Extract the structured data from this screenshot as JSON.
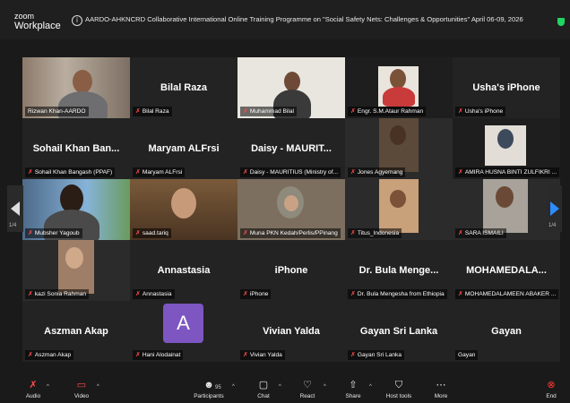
{
  "app": {
    "logo_line1": "zoom",
    "logo_line2": "Workplace"
  },
  "meeting": {
    "info_icon": "i",
    "title": "AARDO-AHKNCRD Collaborative International Online Training Programme on \"Social Safety Nets: Challenges & Opportunities\" April 06-09, 2026"
  },
  "tiles": [
    {
      "big": "",
      "label": "Rizwan Khan-AARDO",
      "muted": false,
      "video": true
    },
    {
      "big": "Bilal Raza",
      "label": "Bilal Raza",
      "muted": true,
      "video": false
    },
    {
      "big": "",
      "label": "Muhammad Bilal",
      "muted": true,
      "video": true
    },
    {
      "big": "",
      "label": "Engr. S.M.Ataur Rahman",
      "muted": true,
      "video": true
    },
    {
      "big": "Usha's iPhone",
      "label": "Usha's iPhone",
      "muted": true,
      "video": false
    },
    {
      "big": "Sohail Khan Ban...",
      "label": "Sohail Khan Bangash (PPAF)",
      "muted": true,
      "video": false
    },
    {
      "big": "Maryam ALFrsi",
      "label": "Maryam ALFrsi",
      "muted": true,
      "video": false
    },
    {
      "big": "Daisy - MAURIT...",
      "label": "Daisy - MAURITIUS (Ministry of...",
      "muted": true,
      "video": false
    },
    {
      "big": "",
      "label": "Jones Agyemang",
      "muted": true,
      "video": true
    },
    {
      "big": "",
      "label": "AMIRA HUSNA BINTI ZULFIKRI ...",
      "muted": true,
      "video": true
    },
    {
      "big": "",
      "label": "Mubsher Yagoub",
      "muted": true,
      "video": true
    },
    {
      "big": "",
      "label": "saad.tariq",
      "muted": true,
      "video": true
    },
    {
      "big": "",
      "label": "Muna PKN Kedah/Perlis/PPinang",
      "muted": true,
      "video": true
    },
    {
      "big": "",
      "label": "Titus_Indonesia",
      "muted": true,
      "video": true
    },
    {
      "big": "",
      "label": "SARA ISMAILI",
      "muted": true,
      "video": true
    },
    {
      "big": "",
      "label": "kazi Sonia Rahman",
      "muted": true,
      "video": true
    },
    {
      "big": "Annastasia",
      "label": "Annastasia",
      "muted": true,
      "video": false
    },
    {
      "big": "iPhone",
      "label": "iPhone",
      "muted": true,
      "video": false
    },
    {
      "big": "Dr. Bula Menge...",
      "label": "Dr. Bula Mengesha from Ethiopia",
      "muted": true,
      "video": false
    },
    {
      "big": "MOHAMEDALA...",
      "label": "MOHAMEDALAMEEN ABAKER ...",
      "muted": true,
      "video": false
    },
    {
      "big": "Aszman Akap",
      "label": "Aszman Akap",
      "muted": true,
      "video": false
    },
    {
      "big": "",
      "label": "Hani Alodainat",
      "muted": true,
      "video": false,
      "avatar": "A"
    },
    {
      "big": "Vivian Yalda",
      "label": "Vivian Yalda",
      "muted": true,
      "video": false
    },
    {
      "big": "Gayan Sri Lanka",
      "label": "Gayan Sri Lanka",
      "muted": true,
      "video": false
    },
    {
      "big": "Gayan",
      "label": "Gayan",
      "muted": false,
      "video": false
    }
  ],
  "pagination": {
    "left": "1/4",
    "right": "1/4"
  },
  "toolbar": {
    "audio": "Audio",
    "video": "Video",
    "participants": "Participants",
    "participants_count": "95",
    "chat": "Chat",
    "react": "React",
    "share": "Share",
    "host_tools": "Host tools",
    "more": "More",
    "end": "End"
  },
  "colors": {
    "accent": "#2d8cff",
    "active_speaker": "#2fe07c",
    "muted": "#ff4a4a",
    "end": "#ff3b30"
  }
}
